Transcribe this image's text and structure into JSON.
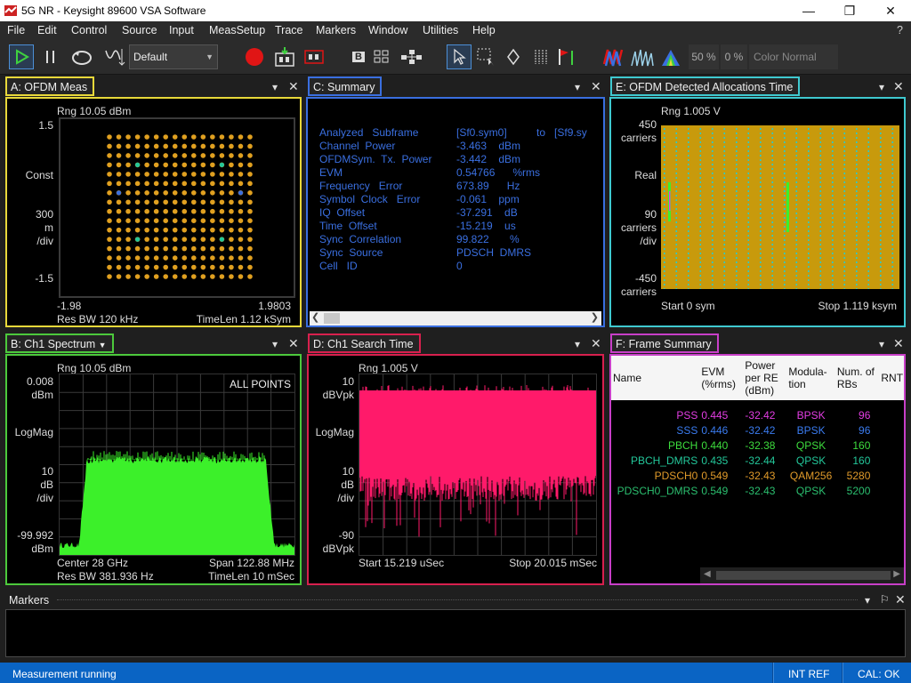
{
  "window": {
    "title": "5G NR - Keysight 89600 VSA Software",
    "help": "?"
  },
  "menu": [
    "File",
    "Edit",
    "Control",
    "Source",
    "Input",
    "MeasSetup",
    "Trace",
    "Markers",
    "Window",
    "Utilities",
    "Help"
  ],
  "toolbar": {
    "preset": "Default",
    "pct1": "50 %",
    "pct2": "0 %",
    "color_mode": "Color Normal"
  },
  "panels": {
    "A": {
      "title": "A: OFDM Meas",
      "rng": "Rng 10.05 dBm",
      "y_top": "1.5",
      "y_label1": "Const",
      "y_div": "300",
      "y_m": "m",
      "y_divu": "/div",
      "y_bot": "-1.5",
      "x_left": "-1.98",
      "x_right": "1.9803",
      "res_bw": "Res BW 120 kHz",
      "timelen": "TimeLen 1.12 kSym"
    },
    "B": {
      "title": "B: Ch1 Spectrum",
      "rng": "Rng 10.05 dBm",
      "y_top": "0.008",
      "y_top_u": "dBm",
      "y_mid": "LogMag",
      "y_div": "10",
      "y_div_u": "dB",
      "y_div_d": "/div",
      "y_bot": "-99.992",
      "y_bot_u": "dBm",
      "badge": "ALL POINTS",
      "center": "Center 28 GHz",
      "span": "Span 122.88 MHz",
      "res_bw": "Res BW 381.936  Hz",
      "timelen": "TimeLen 10 mSec"
    },
    "C": {
      "title": "C: Summary",
      "rows": [
        {
          "k": "Analyzed   Subframe",
          "v": "[Sf0.sym0]          to   [Sf9.sy"
        },
        {
          "k": "Channel  Power",
          "v": "-3.463    dBm"
        },
        {
          "k": "OFDMSym.  Tx.  Power",
          "v": "-3.442    dBm"
        },
        {
          "k": "EVM",
          "v": "0.54766      %rms"
        },
        {
          "k": "Frequency   Error",
          "v": "673.89      Hz"
        },
        {
          "k": "Symbol  Clock   Error",
          "v": "-0.061    ppm"
        },
        {
          "k": "IQ  Offset",
          "v": "-37.291    dB"
        },
        {
          "k": "Time  Offset",
          "v": "-15.219    us"
        },
        {
          "k": "Sync  Correlation",
          "v": "99.822       %"
        },
        {
          "k": "Sync  Source",
          "v": "PDSCH  DMRS"
        },
        {
          "k": "Cell   ID",
          "v": "0"
        }
      ]
    },
    "D": {
      "title": "D: Ch1 Search Time",
      "rng": "Rng 1.005  V",
      "y_top": "10",
      "y_top_u": "dBVpk",
      "y_mid": "LogMag",
      "y_div": "10",
      "y_div_u": "dB",
      "y_div_d": "/div",
      "y_bot": "-90",
      "y_bot_u": "dBVpk",
      "start": "Start 15.219 uSec",
      "stop": "Stop 20.015 mSec"
    },
    "E": {
      "title": "E: OFDM Detected Allocations Time",
      "rng": "Rng 1.005  V",
      "y_top": "450",
      "y_top_u": "carriers",
      "y_mid": "Real",
      "y_div": "90",
      "y_div_u": "carriers",
      "y_div_d": "/div",
      "y_bot": "-450",
      "y_bot_u": "carriers",
      "start": "Start 0  sym",
      "stop": "Stop 1.119 ksym"
    },
    "F": {
      "title": "F: Frame Summary",
      "headers": [
        "Name",
        "EVM\n(%rms)",
        "Power\nper RE\n(dBm)",
        "Modula-\ntion",
        "Num. of\nRBs",
        "RNT"
      ],
      "rows": [
        {
          "name": "PSS",
          "evm": "0.445",
          "power": "-32.42",
          "mod": "BPSK",
          "rbs": "96",
          "color": "#e23de2"
        },
        {
          "name": "SSS",
          "evm": "0.446",
          "power": "-32.42",
          "mod": "BPSK",
          "rbs": "96",
          "color": "#3a7bef"
        },
        {
          "name": "PBCH",
          "evm": "0.440",
          "power": "-32.38",
          "mod": "QPSK",
          "rbs": "160",
          "color": "#3ddc3d"
        },
        {
          "name": "PBCH_DMRS",
          "evm": "0.435",
          "power": "-32.44",
          "mod": "QPSK",
          "rbs": "160",
          "color": "#23c79a"
        },
        {
          "name": "PDSCH0",
          "evm": "0.549",
          "power": "-32.43",
          "mod": "QAM256",
          "rbs": "5280",
          "color": "#e09a2a"
        },
        {
          "name": "PDSCH0_DMRS",
          "evm": "0.549",
          "power": "-32.43",
          "mod": "QPSK",
          "rbs": "5200",
          "color": "#2bbf6f"
        }
      ]
    }
  },
  "markers": {
    "title": "Markers"
  },
  "status": {
    "left": "Measurement running",
    "ref": "INT REF",
    "cal": "CAL: OK"
  },
  "colors": {
    "A": "#e8d83a",
    "B": "#4cc93c",
    "C": "#3a6fe0",
    "D": "#d8204e",
    "E": "#3fc9d0",
    "F": "#c83fc8"
  }
}
